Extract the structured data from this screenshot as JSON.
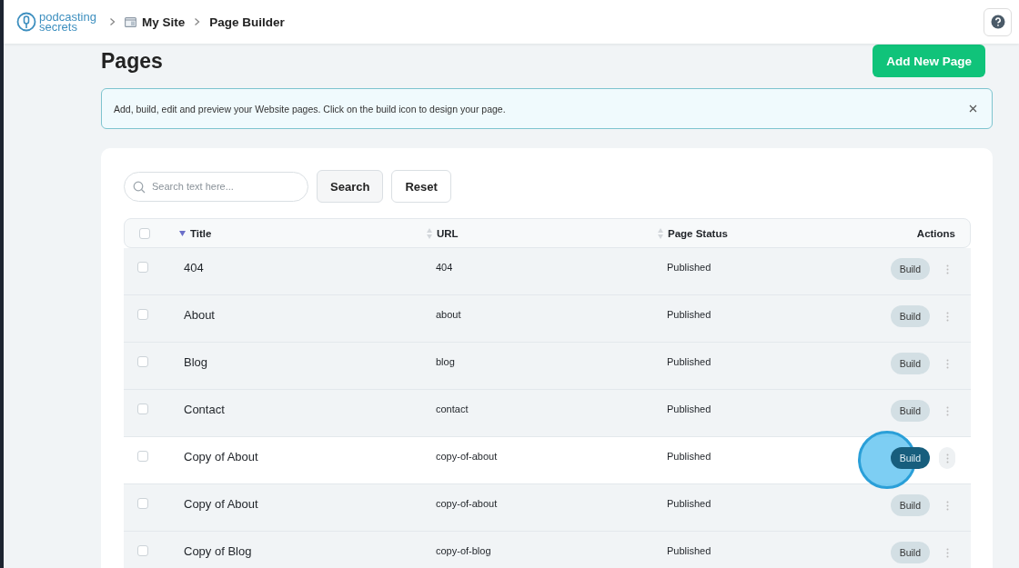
{
  "header": {
    "logo": [
      "podcasting",
      "secrets"
    ],
    "breadcrumbs": [
      "My Site",
      "Page Builder"
    ]
  },
  "page": {
    "title": "Pages",
    "add_button": "Add New Page"
  },
  "banner": {
    "text": "Add, build, edit and preview your Website pages. Click on the build icon to design your page."
  },
  "search": {
    "placeholder": "Search text here...",
    "buttons": [
      "Search",
      "Reset"
    ]
  },
  "table": {
    "select_all": {
      "checked": false
    },
    "columns": [
      {
        "label": "Title",
        "sorted": true
      },
      {
        "label": "URL",
        "sorted": false
      },
      {
        "label": "Page Status",
        "sorted": false
      },
      {
        "label": "Actions"
      }
    ],
    "rows": [
      {
        "title": "404",
        "url": "404",
        "status": "Published",
        "action": "Build",
        "checked": false,
        "hovered": false
      },
      {
        "title": "About",
        "url": "about",
        "status": "Published",
        "action": "Build",
        "checked": false,
        "hovered": false
      },
      {
        "title": "Blog",
        "url": "blog",
        "status": "Published",
        "action": "Build",
        "checked": false,
        "hovered": false
      },
      {
        "title": "Contact",
        "url": "contact",
        "status": "Published",
        "action": "Build",
        "checked": false,
        "hovered": false
      },
      {
        "title": "Copy of About",
        "url": "copy-of-about",
        "status": "Published",
        "action": "Build",
        "checked": false,
        "hovered": true
      },
      {
        "title": "Copy of About",
        "url": "copy-of-about",
        "status": "Published",
        "action": "Build",
        "checked": false,
        "hovered": false
      },
      {
        "title": "Copy of Blog",
        "url": "copy-of-blog",
        "status": "Published",
        "action": "Build",
        "checked": false,
        "hovered": false
      }
    ]
  }
}
